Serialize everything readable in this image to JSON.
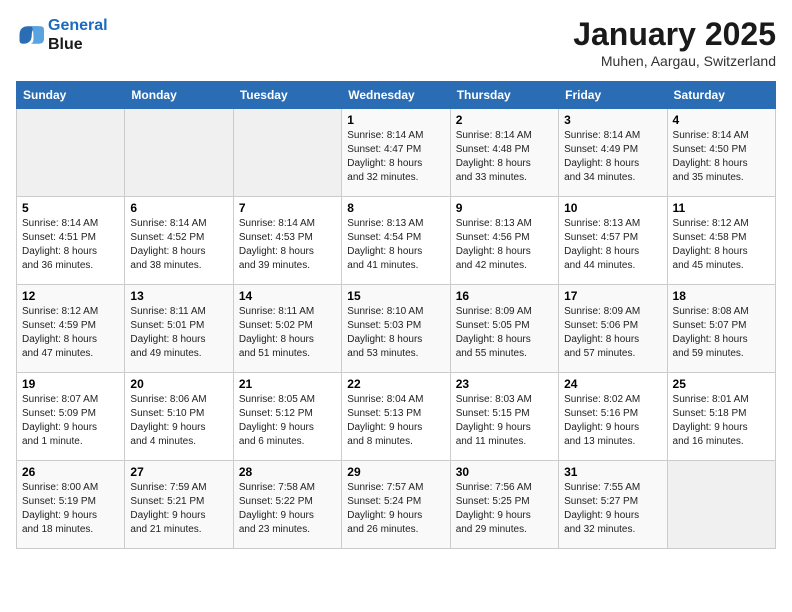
{
  "logo": {
    "line1": "General",
    "line2": "Blue"
  },
  "title": "January 2025",
  "location": "Muhen, Aargau, Switzerland",
  "weekdays": [
    "Sunday",
    "Monday",
    "Tuesday",
    "Wednesday",
    "Thursday",
    "Friday",
    "Saturday"
  ],
  "weeks": [
    [
      {
        "day": "",
        "info": ""
      },
      {
        "day": "",
        "info": ""
      },
      {
        "day": "",
        "info": ""
      },
      {
        "day": "1",
        "info": "Sunrise: 8:14 AM\nSunset: 4:47 PM\nDaylight: 8 hours\nand 32 minutes."
      },
      {
        "day": "2",
        "info": "Sunrise: 8:14 AM\nSunset: 4:48 PM\nDaylight: 8 hours\nand 33 minutes."
      },
      {
        "day": "3",
        "info": "Sunrise: 8:14 AM\nSunset: 4:49 PM\nDaylight: 8 hours\nand 34 minutes."
      },
      {
        "day": "4",
        "info": "Sunrise: 8:14 AM\nSunset: 4:50 PM\nDaylight: 8 hours\nand 35 minutes."
      }
    ],
    [
      {
        "day": "5",
        "info": "Sunrise: 8:14 AM\nSunset: 4:51 PM\nDaylight: 8 hours\nand 36 minutes."
      },
      {
        "day": "6",
        "info": "Sunrise: 8:14 AM\nSunset: 4:52 PM\nDaylight: 8 hours\nand 38 minutes."
      },
      {
        "day": "7",
        "info": "Sunrise: 8:14 AM\nSunset: 4:53 PM\nDaylight: 8 hours\nand 39 minutes."
      },
      {
        "day": "8",
        "info": "Sunrise: 8:13 AM\nSunset: 4:54 PM\nDaylight: 8 hours\nand 41 minutes."
      },
      {
        "day": "9",
        "info": "Sunrise: 8:13 AM\nSunset: 4:56 PM\nDaylight: 8 hours\nand 42 minutes."
      },
      {
        "day": "10",
        "info": "Sunrise: 8:13 AM\nSunset: 4:57 PM\nDaylight: 8 hours\nand 44 minutes."
      },
      {
        "day": "11",
        "info": "Sunrise: 8:12 AM\nSunset: 4:58 PM\nDaylight: 8 hours\nand 45 minutes."
      }
    ],
    [
      {
        "day": "12",
        "info": "Sunrise: 8:12 AM\nSunset: 4:59 PM\nDaylight: 8 hours\nand 47 minutes."
      },
      {
        "day": "13",
        "info": "Sunrise: 8:11 AM\nSunset: 5:01 PM\nDaylight: 8 hours\nand 49 minutes."
      },
      {
        "day": "14",
        "info": "Sunrise: 8:11 AM\nSunset: 5:02 PM\nDaylight: 8 hours\nand 51 minutes."
      },
      {
        "day": "15",
        "info": "Sunrise: 8:10 AM\nSunset: 5:03 PM\nDaylight: 8 hours\nand 53 minutes."
      },
      {
        "day": "16",
        "info": "Sunrise: 8:09 AM\nSunset: 5:05 PM\nDaylight: 8 hours\nand 55 minutes."
      },
      {
        "day": "17",
        "info": "Sunrise: 8:09 AM\nSunset: 5:06 PM\nDaylight: 8 hours\nand 57 minutes."
      },
      {
        "day": "18",
        "info": "Sunrise: 8:08 AM\nSunset: 5:07 PM\nDaylight: 8 hours\nand 59 minutes."
      }
    ],
    [
      {
        "day": "19",
        "info": "Sunrise: 8:07 AM\nSunset: 5:09 PM\nDaylight: 9 hours\nand 1 minute."
      },
      {
        "day": "20",
        "info": "Sunrise: 8:06 AM\nSunset: 5:10 PM\nDaylight: 9 hours\nand 4 minutes."
      },
      {
        "day": "21",
        "info": "Sunrise: 8:05 AM\nSunset: 5:12 PM\nDaylight: 9 hours\nand 6 minutes."
      },
      {
        "day": "22",
        "info": "Sunrise: 8:04 AM\nSunset: 5:13 PM\nDaylight: 9 hours\nand 8 minutes."
      },
      {
        "day": "23",
        "info": "Sunrise: 8:03 AM\nSunset: 5:15 PM\nDaylight: 9 hours\nand 11 minutes."
      },
      {
        "day": "24",
        "info": "Sunrise: 8:02 AM\nSunset: 5:16 PM\nDaylight: 9 hours\nand 13 minutes."
      },
      {
        "day": "25",
        "info": "Sunrise: 8:01 AM\nSunset: 5:18 PM\nDaylight: 9 hours\nand 16 minutes."
      }
    ],
    [
      {
        "day": "26",
        "info": "Sunrise: 8:00 AM\nSunset: 5:19 PM\nDaylight: 9 hours\nand 18 minutes."
      },
      {
        "day": "27",
        "info": "Sunrise: 7:59 AM\nSunset: 5:21 PM\nDaylight: 9 hours\nand 21 minutes."
      },
      {
        "day": "28",
        "info": "Sunrise: 7:58 AM\nSunset: 5:22 PM\nDaylight: 9 hours\nand 23 minutes."
      },
      {
        "day": "29",
        "info": "Sunrise: 7:57 AM\nSunset: 5:24 PM\nDaylight: 9 hours\nand 26 minutes."
      },
      {
        "day": "30",
        "info": "Sunrise: 7:56 AM\nSunset: 5:25 PM\nDaylight: 9 hours\nand 29 minutes."
      },
      {
        "day": "31",
        "info": "Sunrise: 7:55 AM\nSunset: 5:27 PM\nDaylight: 9 hours\nand 32 minutes."
      },
      {
        "day": "",
        "info": ""
      }
    ]
  ]
}
